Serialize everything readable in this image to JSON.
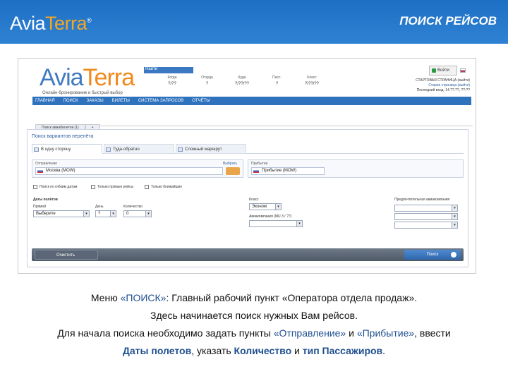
{
  "header": {
    "brand_a": "Avia",
    "brand_b": "Terra",
    "brand_reg": "®",
    "title": "ПОИСК РЕЙСОВ"
  },
  "app": {
    "logo_a": "Avia",
    "logo_b": "Terra",
    "tagline": "Онлайн-бронирование и быстрый выбор",
    "search_header": "Найти",
    "search_cols": [
      {
        "label": "Когда",
        "value": "?/??"
      },
      {
        "label": "Откуда",
        "value": "?"
      },
      {
        "label": "Куда",
        "value": "?/??/??"
      },
      {
        "label": "Пасс.",
        "value": "?"
      },
      {
        "label": "Класс",
        "value": "?/??/??"
      }
    ],
    "login_button": "Войти",
    "account_lines": [
      "СТАРТОВАЯ СТРАНИЦА (выйти)",
      "Старая страница (выйти)",
      "Последний вход: 14.??.??, ??:??"
    ],
    "menu": [
      "Главная",
      "Поиск",
      "Заказы",
      "Билеты",
      "Система запросов",
      "Отчёты"
    ],
    "top_tabs": [
      "Поиск авиабилетов (1)",
      "+"
    ],
    "panel_title": "Поиск вариантов перелёта",
    "search_tabs": [
      "В одну сторону",
      "Туда-обратно",
      "Сложный маршрут"
    ],
    "from_label": "Отправление",
    "from_value": "Москва (MOW)",
    "from_link": "Выбрать",
    "to_label": "Прибытие",
    "to_value": "Прибытие (MOW)",
    "checkboxes": [
      "Поиск по гибким датам",
      "Только прямые рейсы",
      "Только ближайшие"
    ],
    "date_label": "Даты полётов",
    "date_sub": [
      "Прямой",
      "День",
      "Количество"
    ],
    "date_values": [
      "Выберите",
      "?",
      "0"
    ],
    "class_label": "Класс",
    "class_value": "Эконом",
    "airline_label": "Авиакомпания (MU 3 / ??)",
    "pref_label": "Предпочтительная авиакомпания",
    "clear_button": "Очистить",
    "search_button": "Поиск"
  },
  "caption": {
    "l1a": "Меню ",
    "l1b": "«ПОИСК»",
    "l1c": ": Главный рабочий пункт «Оператора отдела продаж».",
    "l2": "Здесь начинается поиск нужных Вам рейсов.",
    "l3a": "Для начала поиска необходимо задать пункты ",
    "l3b": "«Отправление»",
    "l3c": " и ",
    "l3d": "«Прибытие»",
    "l3e": ", ввести",
    "l4a": "Даты полетов",
    "l4b": ", указать ",
    "l4c": "Количество",
    "l4d": " и ",
    "l4e": "тип Пассажиров",
    "l4f": "."
  }
}
